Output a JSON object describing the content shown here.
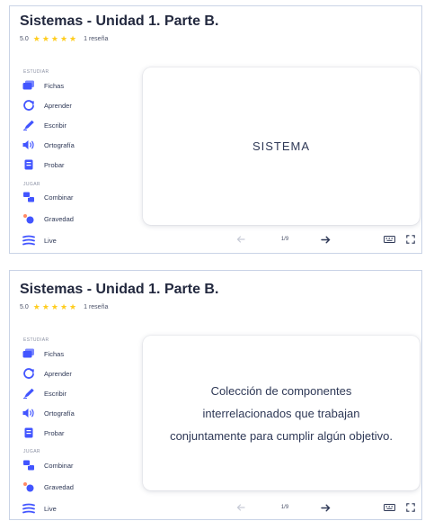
{
  "colors": {
    "title": "#23293f",
    "text": "#2e3856",
    "muted": "#8a90a3",
    "star": "#ffcd1f",
    "icon_blue": "#4255ff",
    "icon_accent": "#ff8a65",
    "panel_border": "#c9d3e6"
  },
  "screens": [
    {
      "title": "Sistemas - Unidad 1. Parte B.",
      "rating": {
        "score": "5.0",
        "stars": 5,
        "reviews": "1 reseña"
      },
      "study_section": "ESTUDIAR",
      "study_items": [
        {
          "label": "Fichas",
          "icon": "flashcards-icon"
        },
        {
          "label": "Aprender",
          "icon": "learn-icon"
        },
        {
          "label": "Escribir",
          "icon": "write-icon"
        },
        {
          "label": "Ortografía",
          "icon": "spell-icon"
        },
        {
          "label": "Probar",
          "icon": "test-icon"
        }
      ],
      "play_section": "JUGAR",
      "play_items": [
        {
          "label": "Combinar",
          "icon": "match-icon"
        },
        {
          "label": "Gravedad",
          "icon": "gravity-icon"
        },
        {
          "label": "Live",
          "icon": "live-icon"
        }
      ],
      "card_text": "SISTEMA",
      "counter": "1/9",
      "prev_icon": "arrow-left-icon",
      "next_icon": "arrow-right-icon"
    },
    {
      "title": "Sistemas - Unidad 1. Parte B.",
      "rating": {
        "score": "5.0",
        "stars": 5,
        "reviews": "1 reseña"
      },
      "study_section": "ESTUDIAR",
      "study_items": [
        {
          "label": "Fichas",
          "icon": "flashcards-icon"
        },
        {
          "label": "Aprender",
          "icon": "learn-icon"
        },
        {
          "label": "Escribir",
          "icon": "write-icon"
        },
        {
          "label": "Ortografía",
          "icon": "spell-icon"
        },
        {
          "label": "Probar",
          "icon": "test-icon"
        }
      ],
      "play_section": "JUGAR",
      "play_items": [
        {
          "label": "Combinar",
          "icon": "match-icon"
        },
        {
          "label": "Gravedad",
          "icon": "gravity-icon"
        },
        {
          "label": "Live",
          "icon": "live-icon"
        }
      ],
      "card_text": "Colección de componentes interrelacionados que trabajan conjuntamente para cumplir algún objetivo.",
      "counter": "1/9",
      "prev_icon": "arrow-left-icon",
      "next_icon": "arrow-right-icon"
    }
  ]
}
